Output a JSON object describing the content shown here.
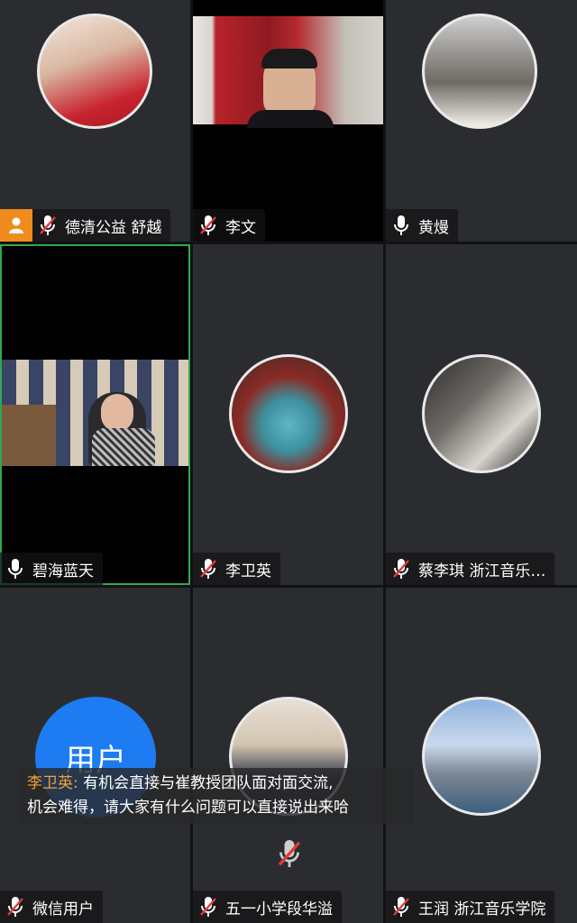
{
  "tiles": [
    {
      "name": "德清公益 舒越",
      "mic": "muted",
      "badge": "person-icon"
    },
    {
      "name": "李文",
      "mic": "muted"
    },
    {
      "name": "黄熳",
      "mic": "on"
    },
    {
      "name": "碧海蓝天",
      "mic": "on",
      "active": true
    },
    {
      "name": "李卫英",
      "mic": "muted"
    },
    {
      "name": "蔡李琪 浙江音乐…",
      "mic": "muted"
    },
    {
      "name": "微信用户",
      "mic": "muted",
      "avatar_text": "用户"
    },
    {
      "name": "五一小学段华溢",
      "mic": "muted"
    },
    {
      "name": "王润 浙江音乐学院",
      "mic": "muted"
    }
  ],
  "subtitle": {
    "speaker": "李卫英:",
    "line1": "有机会直接与崔教授团队面对面交流,",
    "line2": "机会难得，请大家有什么问题可以直接说出来哈"
  },
  "colors": {
    "accent_orange": "#f08c1e",
    "active_border": "#2fa84f",
    "user_blue": "#1e7cf2",
    "muted_red": "#e23b3b"
  }
}
